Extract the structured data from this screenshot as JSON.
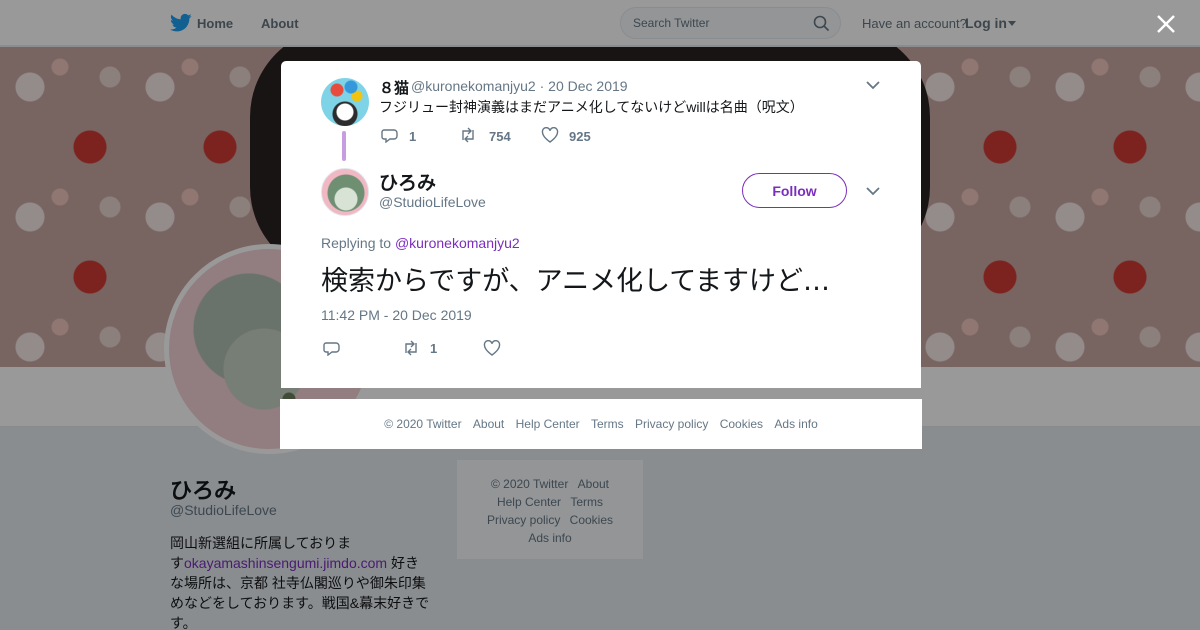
{
  "nav": {
    "home": "Home",
    "about": "About",
    "search_placeholder": "Search Twitter",
    "have_account": "Have an account?",
    "login": "Log in"
  },
  "profile": {
    "name": "ひろみ",
    "handle": "@StudioLifeLove",
    "bio_before": "岡山新選組に所属しておりま",
    "bio_line2_prefix": "す",
    "bio_link": "okayamashinsengumi.jimdo.com",
    "bio_after": " 好きな場所は、京都 社寺仏閣巡りや御朱印集めなどをしております。戦国&幕末好きです。"
  },
  "side_footer": [
    "© 2020 Twitter",
    "About",
    "Help Center",
    "Terms",
    "Privacy policy",
    "Cookies",
    "Ads info"
  ],
  "modal": {
    "parent_tweet": {
      "name": "８猫",
      "handle_date": "@kuronekomanjyu2 · 20 Dec 2019",
      "text": "フジリュー封神演義はまだアニメ化してないけどwillは名曲（呪文）",
      "replies": "1",
      "retweets": "754",
      "likes": "925"
    },
    "main_tweet": {
      "name": "ひろみ",
      "handle": "@StudioLifeLove",
      "follow_label": "Follow",
      "replying_prefix": "Replying to ",
      "replying_to": "@kuronekomanjyu2",
      "text": "検索からですが、アニメ化してますけど…",
      "timestamp": "11:42 PM - 20 Dec 2019",
      "retweets": "1"
    }
  },
  "footer": [
    "© 2020 Twitter",
    "About",
    "Help Center",
    "Terms",
    "Privacy policy",
    "Cookies",
    "Ads info"
  ],
  "colors": {
    "accent": "#7b2ebd",
    "twitter_blue": "#1da1f2",
    "muted": "#657786"
  },
  "icons": [
    "twitter-bird-icon",
    "search-icon",
    "close-icon",
    "chevron-down-icon",
    "reply-icon",
    "retweet-icon",
    "like-icon"
  ]
}
